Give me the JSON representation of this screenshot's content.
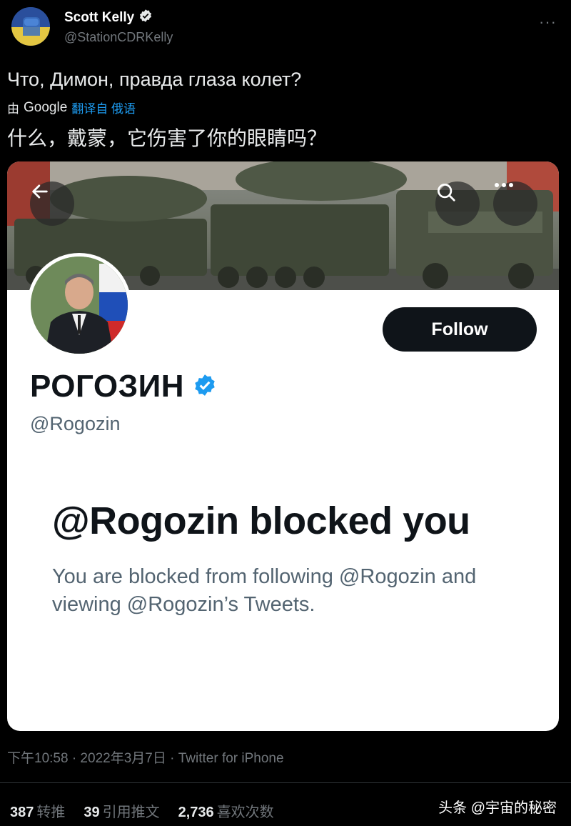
{
  "author": {
    "name": "Scott Kelly",
    "handle": "@StationCDRKelly",
    "more_icon": "ellipsis-icon"
  },
  "tweet": {
    "text": "Что, Димон, правда глаза колет?",
    "translate_by": "由",
    "translate_provider": "Google",
    "translate_link": "翻译自 俄语",
    "translated_text": "什么，戴蒙，它伤害了你的眼睛吗？"
  },
  "embedded_card": {
    "profile_name": "РОГОЗИН",
    "profile_handle": "@Rogozin",
    "follow_label": "Follow",
    "blocked_title": "@Rogozin blocked you",
    "blocked_desc": "You are blocked from following @Rogozin and viewing @Rogozin’s Tweets."
  },
  "meta": {
    "timestamp_line": "下午10:58 · 2022年3月7日 · Twitter for iPhone"
  },
  "stats": {
    "retweets_count": "387",
    "retweets_label": "转推",
    "quotes_count": "39",
    "quotes_label": "引用推文",
    "likes_count": "2,736",
    "likes_label": "喜欢次数"
  },
  "watermark": "头条 @宇宙的秘密",
  "colors": {
    "background": "#000000",
    "link": "#1d9bf0",
    "verified": "#1d9bf0",
    "muted": "#71767b"
  }
}
